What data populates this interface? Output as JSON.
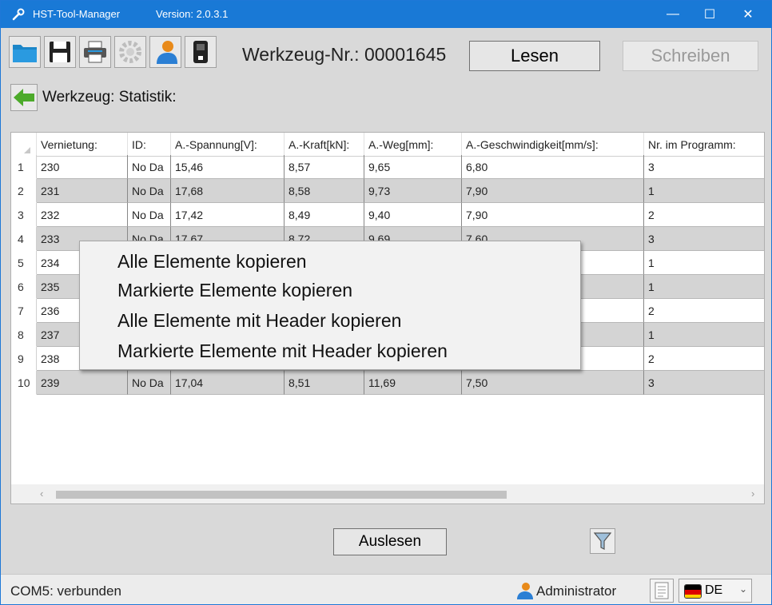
{
  "window": {
    "title": "HST-Tool-Manager",
    "version": "Version: 2.0.3.1",
    "minimize": "—",
    "maximize": "☐",
    "close": "✕"
  },
  "toolbar": {
    "icons": [
      "open-folder-icon",
      "save-icon",
      "print-icon",
      "settings-icon",
      "user-icon",
      "usb-icon"
    ],
    "werkzeug_nr": "Werkzeug-Nr.: 00001645",
    "lesen": "Lesen",
    "schreiben": "Schreiben"
  },
  "breadcrumb": {
    "label": "Werkzeug: Statistik:"
  },
  "grid": {
    "columns": [
      "Vernietung:",
      "ID:",
      "A.-Spannung[V]:",
      "A.-Kraft[kN]:",
      "A.-Weg[mm]:",
      "A.-Geschwindigkeit[mm/s]:",
      "Nr. im Programm:"
    ],
    "rows": [
      {
        "num": "1",
        "cells": [
          "230",
          "No Da",
          "15,46",
          "8,57",
          "9,65",
          "6,80",
          "3"
        ]
      },
      {
        "num": "2",
        "cells": [
          "231",
          "No Da",
          "17,68",
          "8,58",
          "9,73",
          "7,90",
          "1"
        ]
      },
      {
        "num": "3",
        "cells": [
          "232",
          "No Da",
          "17,42",
          "8,49",
          "9,40",
          "7,90",
          "2"
        ]
      },
      {
        "num": "4",
        "cells": [
          "233",
          "No Da",
          "17,67",
          "8,72",
          "9,69",
          "7,60",
          "3"
        ]
      },
      {
        "num": "5",
        "cells": [
          "234",
          "",
          "",
          "",
          "",
          "",
          "1"
        ]
      },
      {
        "num": "6",
        "cells": [
          "235",
          "",
          "",
          "",
          "",
          "",
          "1"
        ]
      },
      {
        "num": "7",
        "cells": [
          "236",
          "",
          "",
          "",
          "",
          "",
          "2"
        ]
      },
      {
        "num": "8",
        "cells": [
          "237",
          "",
          "",
          "",
          "",
          "",
          "1"
        ]
      },
      {
        "num": "9",
        "cells": [
          "238",
          "",
          "",
          "",
          "",
          "",
          "2"
        ]
      },
      {
        "num": "10",
        "cells": [
          "239",
          "No Da",
          "17,04",
          "8,51",
          "11,69",
          "7,50",
          "3"
        ]
      }
    ]
  },
  "context_menu": {
    "items": [
      "Alle Elemente kopieren",
      "Markierte Elemente kopieren",
      "Alle Elemente mit Header kopieren",
      "Markierte Elemente mit Header kopieren"
    ]
  },
  "actions": {
    "auslesen": "Auslesen"
  },
  "status": {
    "connection": "COM5: verbunden",
    "user": "Administrator",
    "language": "DE"
  },
  "colors": {
    "titlebar": "#1979d6",
    "alt_row": "#d4d4d4",
    "window_bg": "#d9d9d9"
  }
}
